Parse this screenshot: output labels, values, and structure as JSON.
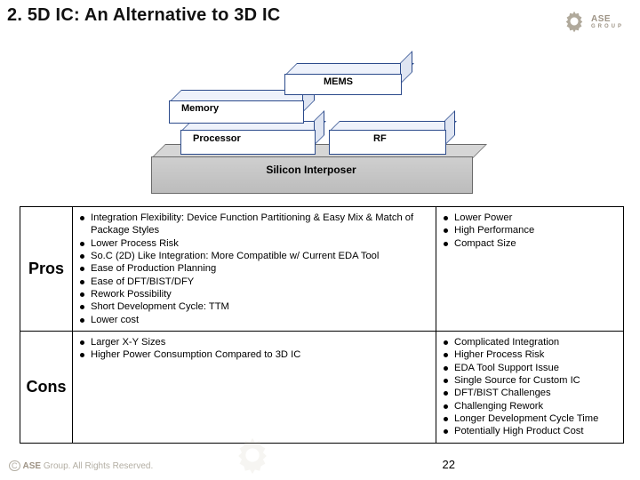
{
  "title": "2. 5D IC: An Alternative to 3D IC",
  "logo": {
    "brand": "ASE",
    "group": "GROUP"
  },
  "diagram": {
    "interposer_label": "Silicon Interposer",
    "processor_label": "Processor",
    "rf_label": "RF",
    "memory_label": "Memory",
    "mems_label": "MEMS"
  },
  "table": {
    "pros_label": "Pros",
    "cons_label": "Cons",
    "pros_left": [
      "Integration Flexibility: Device Function Partitioning & Easy Mix & Match of Package Styles",
      "Lower Process Risk",
      "So.C (2D) Like Integration: More Compatible w/ Current EDA Tool",
      "Ease of Production Planning",
      "Ease of DFT/BIST/DFY",
      "Rework Possibility",
      "Short Development Cycle: TTM",
      "Lower cost"
    ],
    "pros_right": [
      "Lower Power",
      "High Performance",
      "Compact Size"
    ],
    "cons_left": [
      "Larger X-Y Sizes",
      "Higher Power Consumption Compared to 3D IC"
    ],
    "cons_right": [
      "Complicated Integration",
      "Higher Process Risk",
      "EDA Tool Support Issue",
      "Single Source for Custom IC",
      "DFT/BIST Challenges",
      "Challenging Rework",
      "Longer Development Cycle Time",
      "Potentially High Product Cost"
    ]
  },
  "footer": {
    "copyright_brand": "ASE",
    "copyright_rest": " Group. All Rights Reserved."
  },
  "page": "22"
}
